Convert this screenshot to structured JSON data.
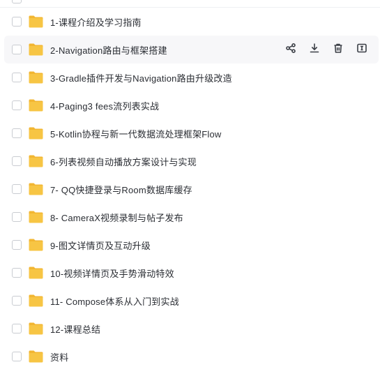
{
  "files": [
    {
      "name": "1-课程介绍及学习指南",
      "type": "folder"
    },
    {
      "name": "2-Navigation路由与框架搭建",
      "type": "folder",
      "hovered": true
    },
    {
      "name": "3-Gradle插件开发与Navigation路由升级改造",
      "type": "folder"
    },
    {
      "name": "4-Paging3 fees流列表实战",
      "type": "folder"
    },
    {
      "name": "5-Kotlin协程与新一代数据流处理框架Flow",
      "type": "folder"
    },
    {
      "name": "6-列表视频自动播放方案设计与实现",
      "type": "folder"
    },
    {
      "name": "7- QQ快捷登录与Room数据库缓存",
      "type": "folder"
    },
    {
      "name": "8- CameraX视频录制与帖子发布",
      "type": "folder"
    },
    {
      "name": "9-图文详情页及互动升级",
      "type": "folder"
    },
    {
      "name": "10-视频详情页及手势滑动特效",
      "type": "folder"
    },
    {
      "name": "11- Compose体系从入门到实战",
      "type": "folder"
    },
    {
      "name": "12-课程总结",
      "type": "folder"
    },
    {
      "name": "资料",
      "type": "folder"
    }
  ],
  "row_actions": [
    {
      "icon": "share-icon"
    },
    {
      "icon": "download-icon"
    },
    {
      "icon": "delete-icon"
    },
    {
      "icon": "rename-icon"
    }
  ],
  "colors": {
    "folder": "#f7c544",
    "folder_tab": "#f2b632",
    "text": "#2a2d33",
    "icon": "#3b3f46",
    "hover_bg": "#f7f7f9"
  }
}
